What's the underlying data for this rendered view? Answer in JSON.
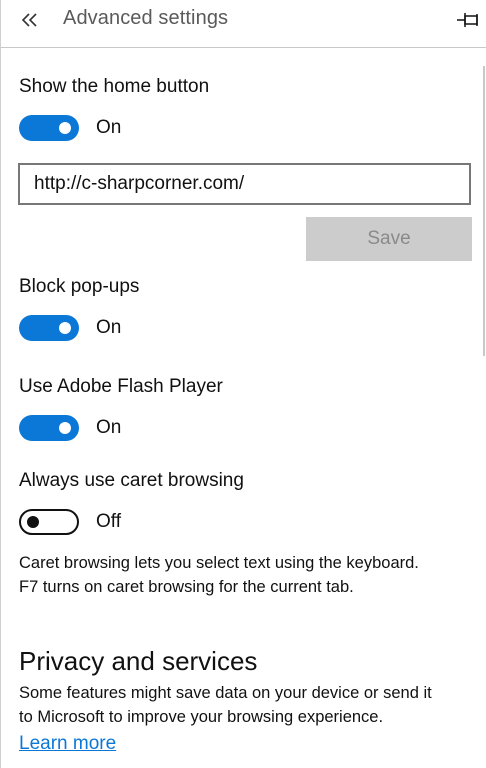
{
  "header": {
    "back_icon": "double-chevron-left-icon",
    "title": "Advanced settings",
    "pin_icon": "pin-icon"
  },
  "home_button": {
    "label": "Show the home button",
    "state": "On",
    "url_value": "http://c-sharpcorner.com/",
    "save_label": "Save"
  },
  "popups": {
    "label": "Block pop-ups",
    "state": "On"
  },
  "flash": {
    "label": "Use Adobe Flash Player",
    "state": "On"
  },
  "caret": {
    "label": "Always use caret browsing",
    "state": "Off",
    "description_line1": "Caret browsing lets you select text using the keyboard.",
    "description_line2": "F7 turns on caret browsing for the current tab."
  },
  "privacy": {
    "heading": "Privacy and services",
    "description_line1": "Some features might save data on your device or send it",
    "description_line2": "to Microsoft to improve your browsing experience.",
    "learn_more": "Learn more"
  },
  "colors": {
    "accent": "#0b78d7",
    "disabled_button": "#cccccc"
  }
}
